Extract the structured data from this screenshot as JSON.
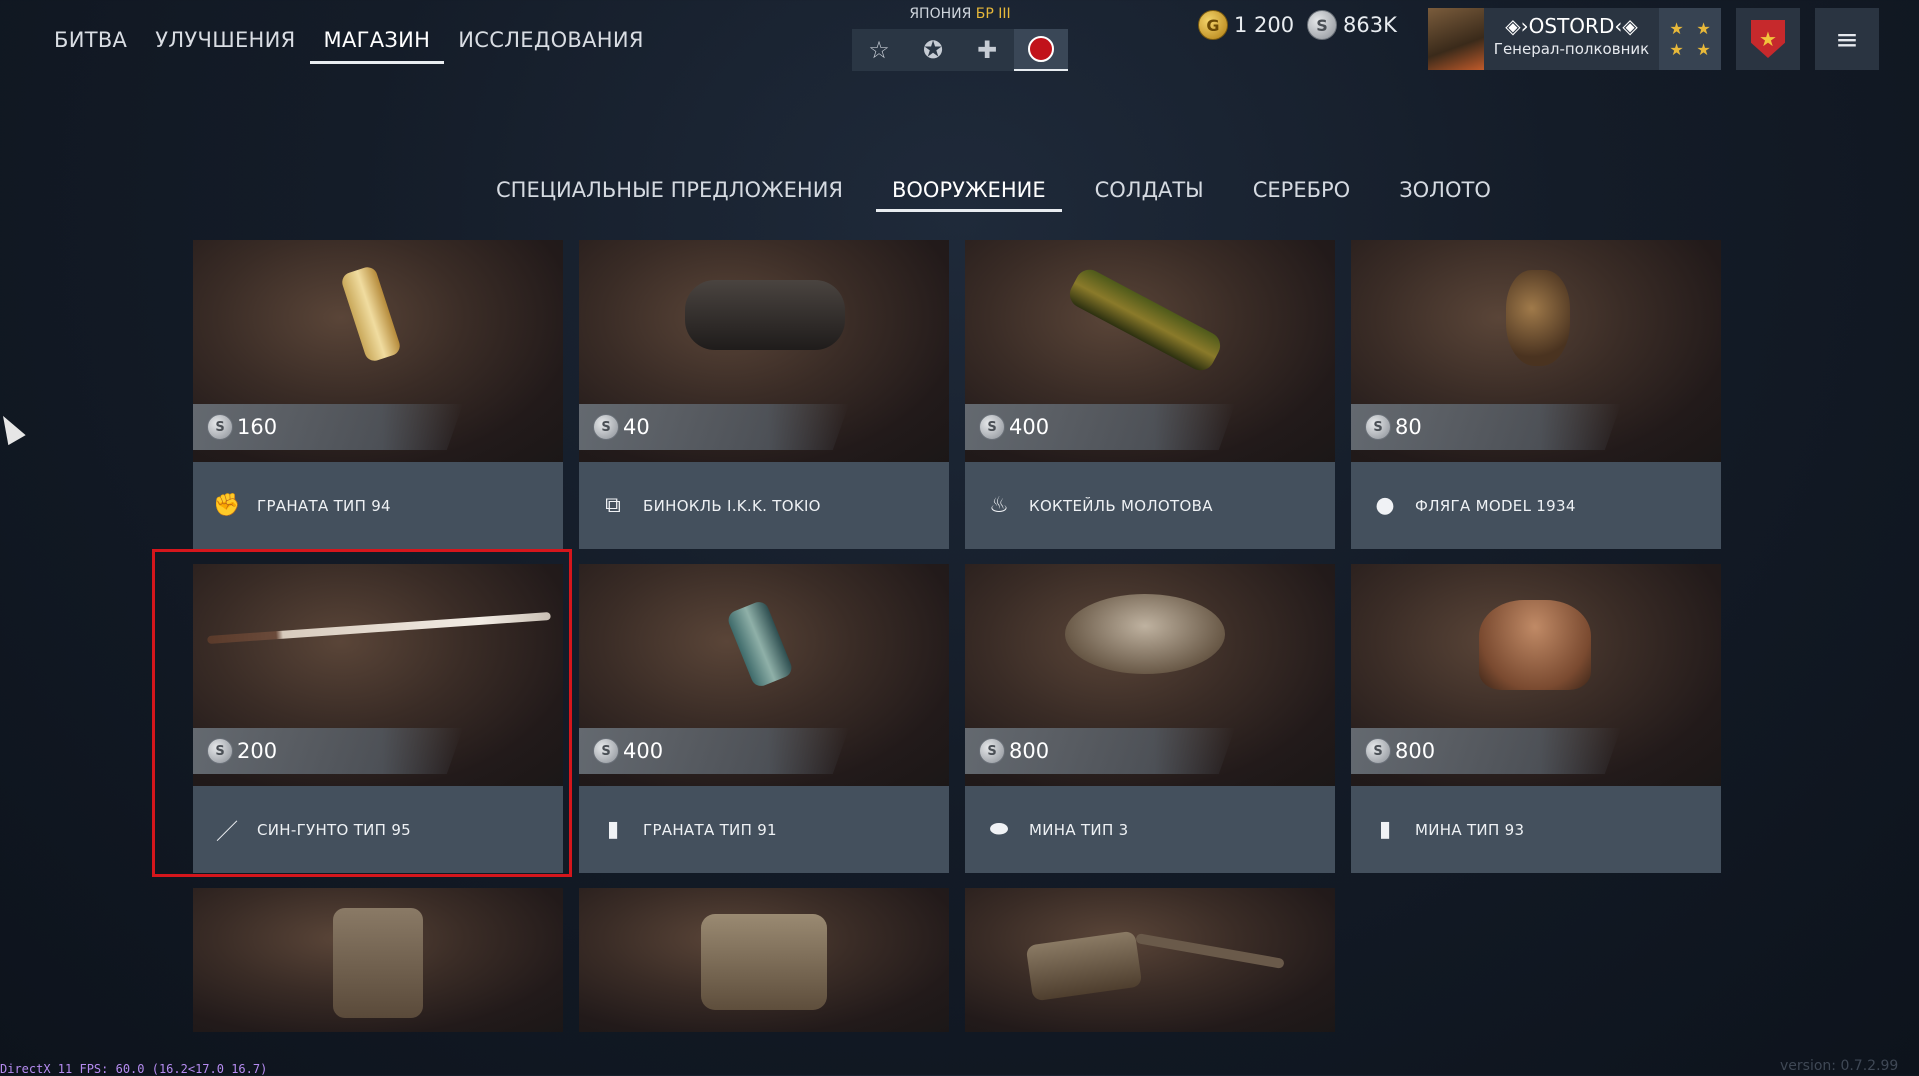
{
  "top_nav": [
    {
      "label": "БИТВА",
      "active": false
    },
    {
      "label": "УЛУЧШЕНИЯ",
      "active": false
    },
    {
      "label": "МАГАЗИН",
      "active": true
    },
    {
      "label": "ИССЛЕДОВАНИЯ",
      "active": false
    }
  ],
  "nation": {
    "name": "ЯПОНИЯ",
    "br": "БР III"
  },
  "modes": [
    {
      "icon": "star-outline-icon",
      "glyph": "☆"
    },
    {
      "icon": "star-circle-icon",
      "glyph": "✪"
    },
    {
      "icon": "cross-icon",
      "glyph": "✚"
    },
    {
      "icon": "japan-roundel-icon",
      "glyph": ""
    }
  ],
  "currency": {
    "gold": "1 200",
    "silver": "863K",
    "gold_symbol": "G",
    "silver_symbol": "S"
  },
  "profile": {
    "name": "◈›OSTORD‹◈",
    "rank": "Генерал-полковник",
    "rank_stars": [
      "★",
      "★",
      "★",
      "★"
    ]
  },
  "menu_glyph": "≡",
  "badge_glyph": "★",
  "sub_tabs": [
    {
      "label": "СПЕЦИАЛЬНЫЕ ПРЕДЛОЖЕНИЯ",
      "active": false
    },
    {
      "label": "ВООРУЖЕНИЕ",
      "active": true
    },
    {
      "label": "СОЛДАТЫ",
      "active": false
    },
    {
      "label": "СЕРЕБРО",
      "active": false
    },
    {
      "label": "ЗОЛОТО",
      "active": false
    }
  ],
  "items": [
    {
      "name": "ГРАНАТА ТИП 94",
      "price": "160",
      "icon": "grenade-icon",
      "glyph": "✊"
    },
    {
      "name": "БИНОКЛЬ I.K.K. TOKIO",
      "price": "40",
      "icon": "binoculars-icon",
      "glyph": "⧉"
    },
    {
      "name": "КОКТЕЙЛЬ МОЛОТОВА",
      "price": "400",
      "icon": "molotov-icon",
      "glyph": "♨"
    },
    {
      "name": "ФЛЯГА MODEL 1934",
      "price": "80",
      "icon": "flask-icon",
      "glyph": "●"
    },
    {
      "name": "СИН-ГУНТО ТИП 95",
      "price": "200",
      "icon": "sword-icon",
      "glyph": "／"
    },
    {
      "name": "ГРАНАТА ТИП 91",
      "price": "400",
      "icon": "grenade-type91-icon",
      "glyph": "▮"
    },
    {
      "name": "МИНА ТИП 3",
      "price": "800",
      "icon": "mine-icon",
      "glyph": "⬬"
    },
    {
      "name": "МИНА ТИП 93",
      "price": "800",
      "icon": "mine-type93-icon",
      "glyph": "▮"
    }
  ],
  "footer": {
    "left": "DirectX 11 FPS: 60.0 (16.2<17.0 16.7)",
    "right": "version: 0.7.2.99"
  }
}
